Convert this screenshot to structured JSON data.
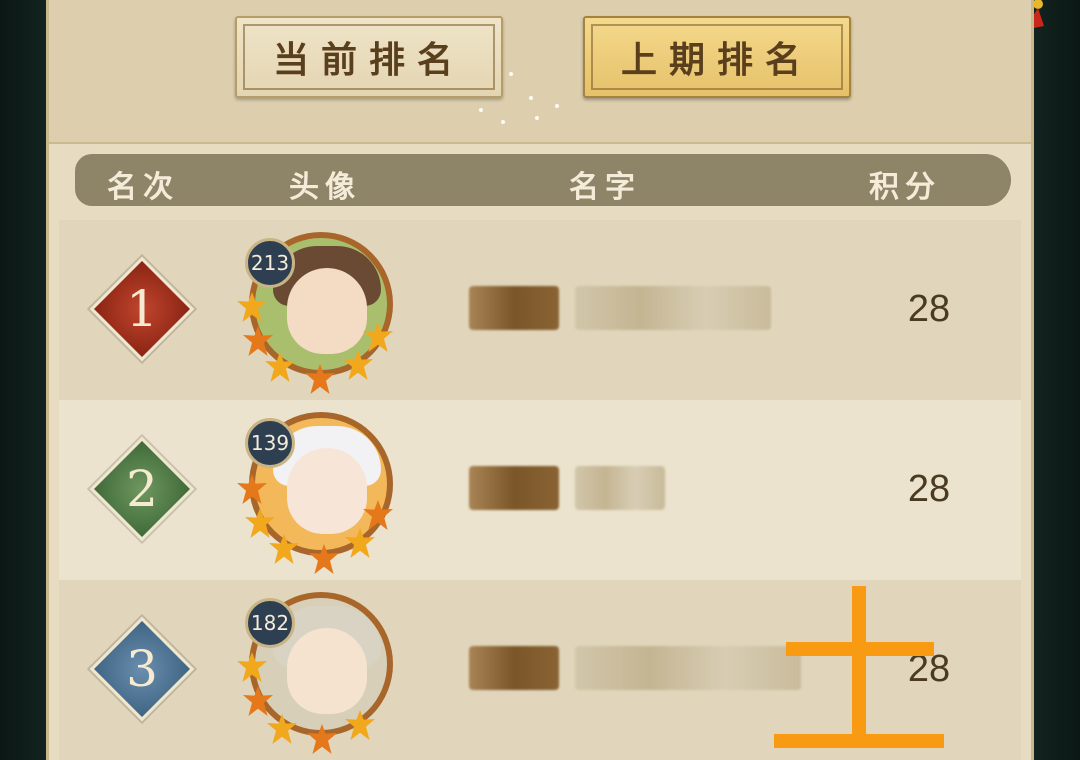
{
  "tabs": {
    "current_label": "当前排名",
    "previous_label": "上期排名",
    "active": "previous"
  },
  "header": {
    "rank": "名次",
    "avatar": "头像",
    "name": "名字",
    "score": "积分"
  },
  "rows": [
    {
      "rank": "1",
      "level": "213",
      "score": "28"
    },
    {
      "rank": "2",
      "level": "139",
      "score": "28"
    },
    {
      "rank": "3",
      "level": "182",
      "score": "28"
    }
  ],
  "colors": {
    "accent_tab": "#e6c16a",
    "rank1": "#a9321e",
    "rank2": "#527f4a",
    "rank3": "#527a9c",
    "annotation": "#f89a12"
  }
}
